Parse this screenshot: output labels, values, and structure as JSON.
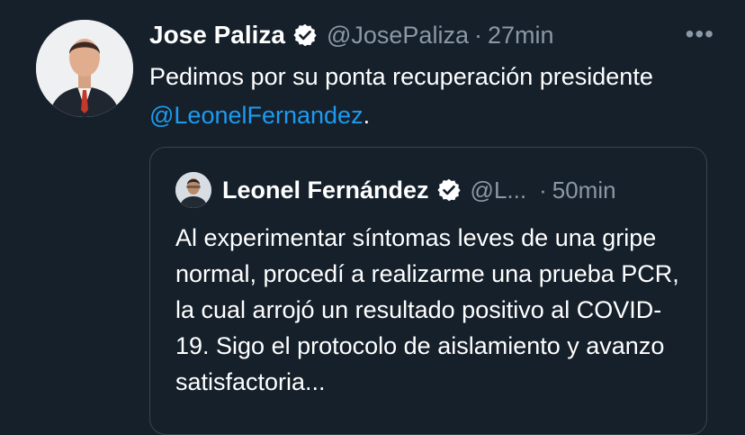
{
  "tweet": {
    "author_name": "Jose Paliza",
    "author_handle": "@JosePaliza",
    "separator": "·",
    "time": "27min",
    "more_label": "•••",
    "text_before": "Pedimos por su ponta recuperación presidente ",
    "mention": "@LeonelFernandez",
    "text_after": "."
  },
  "quoted": {
    "author_name": "Leonel Fernández",
    "author_handle": "@L...",
    "separator": "·",
    "time": "50min",
    "text": "Al experimentar síntomas leves de una gripe normal, procedí a realizarme una prueba PCR, la cual arrojó un resultado positivo al COVID-19. Sigo el protocolo de aislamiento y avanzo satisfactoria..."
  },
  "colors": {
    "background": "#15202b",
    "accent": "#1d9bf0",
    "muted": "#8b98a5",
    "border": "#38444d"
  }
}
